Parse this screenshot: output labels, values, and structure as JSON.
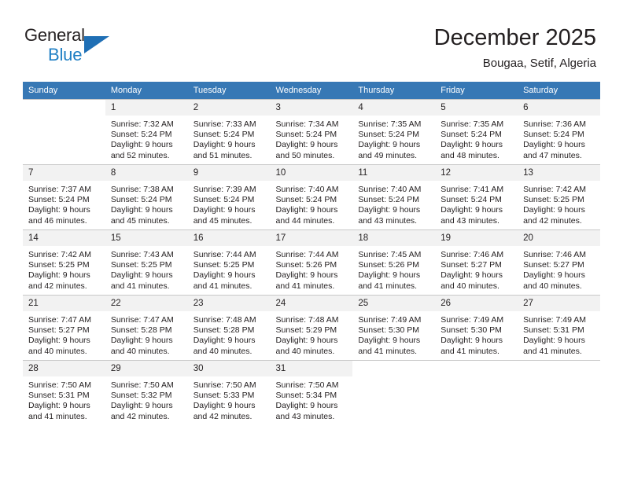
{
  "brand": {
    "name_part1": "General",
    "name_part2": "Blue",
    "triangle_color": "#1f6fb5",
    "blue_color": "#1f7fc4"
  },
  "header": {
    "title": "December 2025",
    "subtitle": "Bougaa, Setif, Algeria"
  },
  "theme": {
    "header_row_bg": "#3778b5",
    "header_row_text": "#ffffff",
    "daynum_bg": "#f2f2f2",
    "cell_border": "#c8c8c8",
    "body_text": "#231f20"
  },
  "weekdays": [
    "Sunday",
    "Monday",
    "Tuesday",
    "Wednesday",
    "Thursday",
    "Friday",
    "Saturday"
  ],
  "weeks": [
    [
      {
        "day": "",
        "sunrise": "",
        "sunset": "",
        "daylight1": "",
        "daylight2": "",
        "empty": true
      },
      {
        "day": "1",
        "sunrise": "Sunrise: 7:32 AM",
        "sunset": "Sunset: 5:24 PM",
        "daylight1": "Daylight: 9 hours",
        "daylight2": "and 52 minutes.",
        "empty": false
      },
      {
        "day": "2",
        "sunrise": "Sunrise: 7:33 AM",
        "sunset": "Sunset: 5:24 PM",
        "daylight1": "Daylight: 9 hours",
        "daylight2": "and 51 minutes.",
        "empty": false
      },
      {
        "day": "3",
        "sunrise": "Sunrise: 7:34 AM",
        "sunset": "Sunset: 5:24 PM",
        "daylight1": "Daylight: 9 hours",
        "daylight2": "and 50 minutes.",
        "empty": false
      },
      {
        "day": "4",
        "sunrise": "Sunrise: 7:35 AM",
        "sunset": "Sunset: 5:24 PM",
        "daylight1": "Daylight: 9 hours",
        "daylight2": "and 49 minutes.",
        "empty": false
      },
      {
        "day": "5",
        "sunrise": "Sunrise: 7:35 AM",
        "sunset": "Sunset: 5:24 PM",
        "daylight1": "Daylight: 9 hours",
        "daylight2": "and 48 minutes.",
        "empty": false
      },
      {
        "day": "6",
        "sunrise": "Sunrise: 7:36 AM",
        "sunset": "Sunset: 5:24 PM",
        "daylight1": "Daylight: 9 hours",
        "daylight2": "and 47 minutes.",
        "empty": false
      }
    ],
    [
      {
        "day": "7",
        "sunrise": "Sunrise: 7:37 AM",
        "sunset": "Sunset: 5:24 PM",
        "daylight1": "Daylight: 9 hours",
        "daylight2": "and 46 minutes.",
        "empty": false
      },
      {
        "day": "8",
        "sunrise": "Sunrise: 7:38 AM",
        "sunset": "Sunset: 5:24 PM",
        "daylight1": "Daylight: 9 hours",
        "daylight2": "and 45 minutes.",
        "empty": false
      },
      {
        "day": "9",
        "sunrise": "Sunrise: 7:39 AM",
        "sunset": "Sunset: 5:24 PM",
        "daylight1": "Daylight: 9 hours",
        "daylight2": "and 45 minutes.",
        "empty": false
      },
      {
        "day": "10",
        "sunrise": "Sunrise: 7:40 AM",
        "sunset": "Sunset: 5:24 PM",
        "daylight1": "Daylight: 9 hours",
        "daylight2": "and 44 minutes.",
        "empty": false
      },
      {
        "day": "11",
        "sunrise": "Sunrise: 7:40 AM",
        "sunset": "Sunset: 5:24 PM",
        "daylight1": "Daylight: 9 hours",
        "daylight2": "and 43 minutes.",
        "empty": false
      },
      {
        "day": "12",
        "sunrise": "Sunrise: 7:41 AM",
        "sunset": "Sunset: 5:24 PM",
        "daylight1": "Daylight: 9 hours",
        "daylight2": "and 43 minutes.",
        "empty": false
      },
      {
        "day": "13",
        "sunrise": "Sunrise: 7:42 AM",
        "sunset": "Sunset: 5:25 PM",
        "daylight1": "Daylight: 9 hours",
        "daylight2": "and 42 minutes.",
        "empty": false
      }
    ],
    [
      {
        "day": "14",
        "sunrise": "Sunrise: 7:42 AM",
        "sunset": "Sunset: 5:25 PM",
        "daylight1": "Daylight: 9 hours",
        "daylight2": "and 42 minutes.",
        "empty": false
      },
      {
        "day": "15",
        "sunrise": "Sunrise: 7:43 AM",
        "sunset": "Sunset: 5:25 PM",
        "daylight1": "Daylight: 9 hours",
        "daylight2": "and 41 minutes.",
        "empty": false
      },
      {
        "day": "16",
        "sunrise": "Sunrise: 7:44 AM",
        "sunset": "Sunset: 5:25 PM",
        "daylight1": "Daylight: 9 hours",
        "daylight2": "and 41 minutes.",
        "empty": false
      },
      {
        "day": "17",
        "sunrise": "Sunrise: 7:44 AM",
        "sunset": "Sunset: 5:26 PM",
        "daylight1": "Daylight: 9 hours",
        "daylight2": "and 41 minutes.",
        "empty": false
      },
      {
        "day": "18",
        "sunrise": "Sunrise: 7:45 AM",
        "sunset": "Sunset: 5:26 PM",
        "daylight1": "Daylight: 9 hours",
        "daylight2": "and 41 minutes.",
        "empty": false
      },
      {
        "day": "19",
        "sunrise": "Sunrise: 7:46 AM",
        "sunset": "Sunset: 5:27 PM",
        "daylight1": "Daylight: 9 hours",
        "daylight2": "and 40 minutes.",
        "empty": false
      },
      {
        "day": "20",
        "sunrise": "Sunrise: 7:46 AM",
        "sunset": "Sunset: 5:27 PM",
        "daylight1": "Daylight: 9 hours",
        "daylight2": "and 40 minutes.",
        "empty": false
      }
    ],
    [
      {
        "day": "21",
        "sunrise": "Sunrise: 7:47 AM",
        "sunset": "Sunset: 5:27 PM",
        "daylight1": "Daylight: 9 hours",
        "daylight2": "and 40 minutes.",
        "empty": false
      },
      {
        "day": "22",
        "sunrise": "Sunrise: 7:47 AM",
        "sunset": "Sunset: 5:28 PM",
        "daylight1": "Daylight: 9 hours",
        "daylight2": "and 40 minutes.",
        "empty": false
      },
      {
        "day": "23",
        "sunrise": "Sunrise: 7:48 AM",
        "sunset": "Sunset: 5:28 PM",
        "daylight1": "Daylight: 9 hours",
        "daylight2": "and 40 minutes.",
        "empty": false
      },
      {
        "day": "24",
        "sunrise": "Sunrise: 7:48 AM",
        "sunset": "Sunset: 5:29 PM",
        "daylight1": "Daylight: 9 hours",
        "daylight2": "and 40 minutes.",
        "empty": false
      },
      {
        "day": "25",
        "sunrise": "Sunrise: 7:49 AM",
        "sunset": "Sunset: 5:30 PM",
        "daylight1": "Daylight: 9 hours",
        "daylight2": "and 41 minutes.",
        "empty": false
      },
      {
        "day": "26",
        "sunrise": "Sunrise: 7:49 AM",
        "sunset": "Sunset: 5:30 PM",
        "daylight1": "Daylight: 9 hours",
        "daylight2": "and 41 minutes.",
        "empty": false
      },
      {
        "day": "27",
        "sunrise": "Sunrise: 7:49 AM",
        "sunset": "Sunset: 5:31 PM",
        "daylight1": "Daylight: 9 hours",
        "daylight2": "and 41 minutes.",
        "empty": false
      }
    ],
    [
      {
        "day": "28",
        "sunrise": "Sunrise: 7:50 AM",
        "sunset": "Sunset: 5:31 PM",
        "daylight1": "Daylight: 9 hours",
        "daylight2": "and 41 minutes.",
        "empty": false
      },
      {
        "day": "29",
        "sunrise": "Sunrise: 7:50 AM",
        "sunset": "Sunset: 5:32 PM",
        "daylight1": "Daylight: 9 hours",
        "daylight2": "and 42 minutes.",
        "empty": false
      },
      {
        "day": "30",
        "sunrise": "Sunrise: 7:50 AM",
        "sunset": "Sunset: 5:33 PM",
        "daylight1": "Daylight: 9 hours",
        "daylight2": "and 42 minutes.",
        "empty": false
      },
      {
        "day": "31",
        "sunrise": "Sunrise: 7:50 AM",
        "sunset": "Sunset: 5:34 PM",
        "daylight1": "Daylight: 9 hours",
        "daylight2": "and 43 minutes.",
        "empty": false
      },
      {
        "day": "",
        "sunrise": "",
        "sunset": "",
        "daylight1": "",
        "daylight2": "",
        "empty": true
      },
      {
        "day": "",
        "sunrise": "",
        "sunset": "",
        "daylight1": "",
        "daylight2": "",
        "empty": true
      },
      {
        "day": "",
        "sunrise": "",
        "sunset": "",
        "daylight1": "",
        "daylight2": "",
        "empty": true
      }
    ]
  ]
}
